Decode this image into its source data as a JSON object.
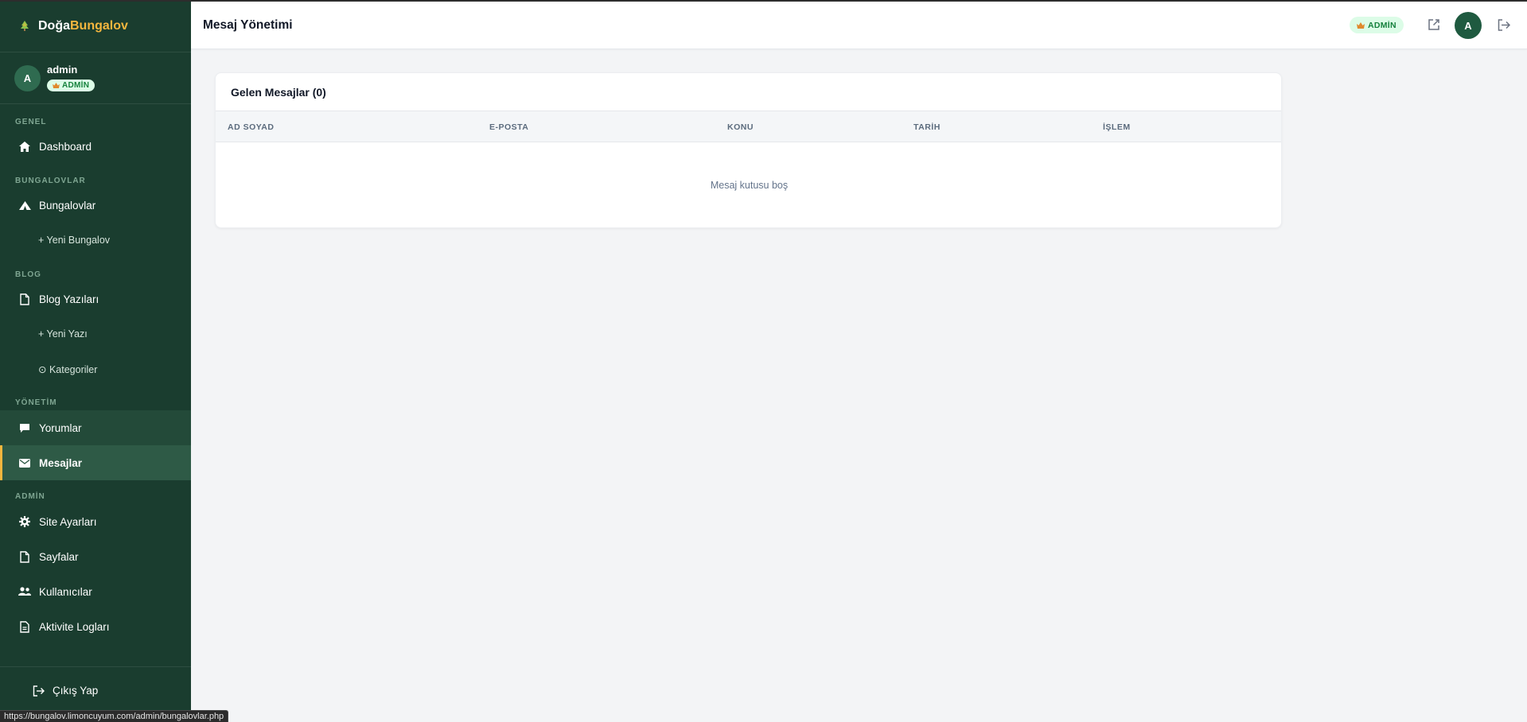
{
  "brand": {
    "part1": "Doğa",
    "part2": "Bungalov"
  },
  "user": {
    "initial": "A",
    "name": "admin",
    "role": "ADMİN"
  },
  "sidebar": {
    "sections": {
      "genel": "GENEL",
      "bungalovlar": "BUNGALOVLAR",
      "blog": "BLOG",
      "yonetim": "YÖNETİM",
      "admin": "ADMİN"
    },
    "items": {
      "dashboard": "Dashboard",
      "bungalovlar": "Bungalovlar",
      "yeni_bungalov": "+ Yeni Bungalov",
      "blog_yazilari": "Blog Yazıları",
      "yeni_yazi": "+ Yeni Yazı",
      "kategoriler": "⊙ Kategoriler",
      "yorumlar": "Yorumlar",
      "mesajlar": "Mesajlar",
      "site_ayarlari": "Site Ayarları",
      "sayfalar": "Sayfalar",
      "kullanicilar": "Kullanıcılar",
      "aktivite_loglari": "Aktivite Logları"
    },
    "logout": "Çıkış Yap"
  },
  "header": {
    "title": "Mesaj Yönetimi",
    "role_badge": "ADMİN",
    "avatar_initial": "A"
  },
  "messages": {
    "title": "Gelen Mesajlar (0)",
    "columns": [
      "AD SOYAD",
      "E-POSTA",
      "KONU",
      "TARİH",
      "İŞLEM"
    ],
    "empty_text": "Mesaj kutusu boş"
  },
  "status_url": "https://bungalov.limoncuyum.com/admin/bungalovlar.php",
  "colors": {
    "sidebar_bg": "#1a3d2f",
    "accent": "#f4b63e",
    "badge_bg": "#dcfce7",
    "badge_text": "#15803d"
  },
  "icons": [
    "tree-icon",
    "crown-icon",
    "home-icon",
    "tent-icon",
    "file-icon",
    "comment-icon",
    "mail-icon",
    "gear-icon",
    "users-icon",
    "log-icon",
    "logout-icon",
    "external-link-icon"
  ]
}
